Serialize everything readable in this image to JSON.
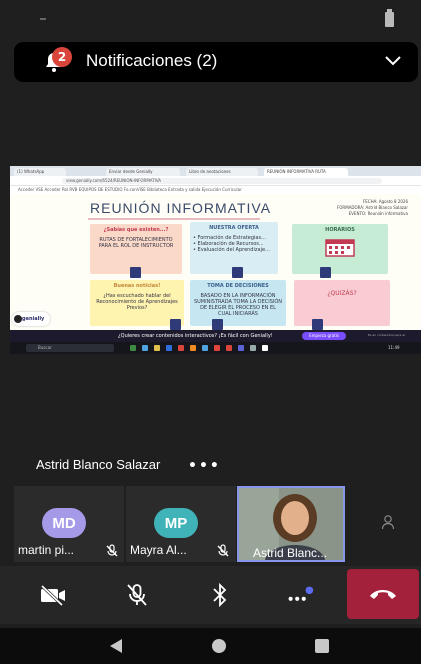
{
  "notifications": {
    "title": "Notificaciones (2)",
    "badge_count": "2"
  },
  "shared_screen": {
    "browser_tabs": [
      "(1) WhatsApp",
      "Enviar desde Genially",
      "Libro de anotaciones",
      "REUNIÓN INFORMATIVA RUTA"
    ],
    "url": "view.genially.com/6524/REUNION-INFORMATIVA",
    "bookmarks": "Acceder VSE   Acceder   Rol RVB   EQUIPOS DE ESTUDIO   Fo.conVISE   Biblioteca   Entrada y salida   Ejecución Curricular",
    "slide": {
      "title": "REUNIÓN INFORMATIVA",
      "meta_lines": [
        "FECHA: Agosto 8 2026",
        "FORMADORA: Astrid Blanco Salazar",
        "EVENTO: Reunión informativa"
      ],
      "cards": [
        {
          "title": "¿Sabías que existen...?",
          "body": "RUTAS DE FORTALECIMIENTO PARA EL ROL DE INSTRUCTOR"
        },
        {
          "title": "NUESTRA OFERTA",
          "body": "• Formación de Estrategias...\n• Elaboración de Recursos...\n• Evaluación del Aprendizaje..."
        },
        {
          "title": "HORARIOS",
          "body": ""
        },
        {
          "title": "Buenas noticias!",
          "body": "¿Has escuchado hablar del Reconocimiento de Aprendizajes Previos?"
        },
        {
          "title": "TOMA DE DECISIONES",
          "body": "BASADO EN LA INFORMACIÓN SUMINISTRADA TOMA LA DECISIÓN DE ELEGIR EL PROCESO EN EL CUAL INICIARÁS"
        },
        {
          "title": "",
          "body": "¿QUIZÁS?"
        }
      ],
      "logo": "genially"
    },
    "promo_text": "¿Quieres crear contenidos interactivos? ¡Es fácil con Genially!",
    "promo_button": "Empieza gratis",
    "promo_side": "Es en contenidos para el",
    "taskbar_search": "Buscar",
    "taskbar_clock": "11:49"
  },
  "speaker": {
    "name": "Astrid Blanco Salazar",
    "more": "•••"
  },
  "participants": [
    {
      "initials": "MD",
      "name": "martin pi...",
      "avatar_color": "#a59ae8",
      "muted": true
    },
    {
      "initials": "MP",
      "name": "Mayra Al...",
      "avatar_color": "#3fb3b7",
      "muted": true
    },
    {
      "initials": "",
      "name": "Astrid Blanc...",
      "avatar_color": "",
      "muted": false
    }
  ],
  "controls": {
    "camera": "camera-off",
    "mic": "mic-off",
    "audio": "bluetooth",
    "more": "more",
    "hangup": "hang-up"
  },
  "colors": {
    "accent": "#8796e8",
    "hangup": "#a3213a",
    "badge": "#d9453b"
  }
}
